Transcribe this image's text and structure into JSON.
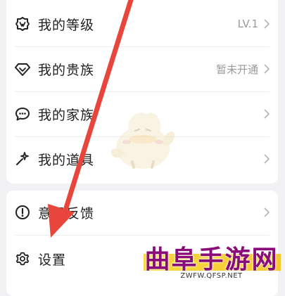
{
  "menu_group_1": [
    {
      "label": "我的等级",
      "value": "LV.1",
      "icon": "level-badge-icon"
    },
    {
      "label": "我的贵族",
      "value": "暂未开通",
      "icon": "diamond-icon"
    },
    {
      "label": "我的家族",
      "value": "",
      "icon": "chat-bubbles-icon"
    },
    {
      "label": "我的道具",
      "value": "",
      "icon": "magic-wand-icon"
    }
  ],
  "menu_group_2": [
    {
      "label": "意见反馈",
      "icon": "exclamation-circle-icon"
    },
    {
      "label": "设置",
      "icon": "gear-icon"
    }
  ],
  "watermark": {
    "title": "曲阜手游网",
    "url": "ZWFW.QFSP.NET"
  },
  "colors": {
    "arrow": "#e8453c",
    "watermark_title": "#8a0c7a",
    "watermark_band": "#f5cd33"
  }
}
